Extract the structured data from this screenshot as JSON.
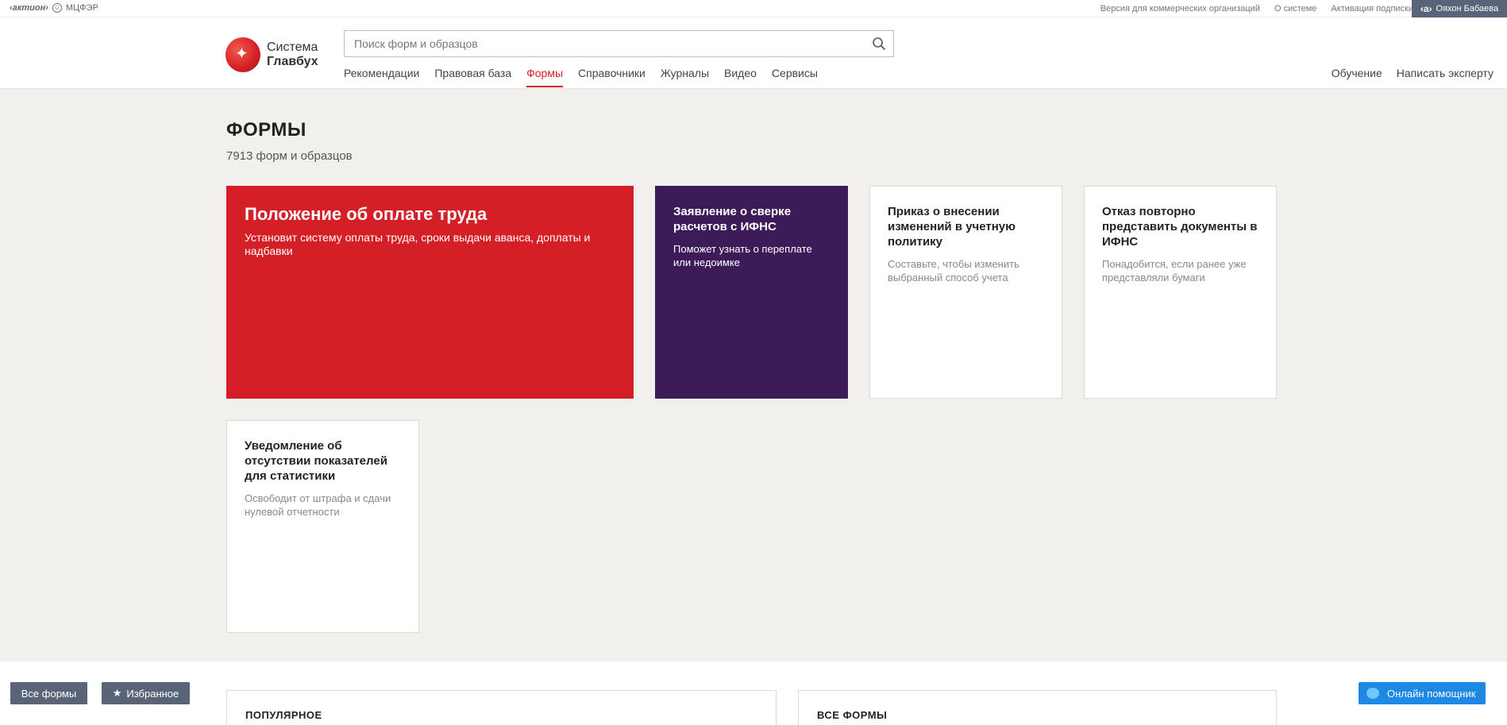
{
  "topbar": {
    "brand_main": "‹актион›",
    "brand_sub": "МЦФЭР",
    "links": [
      "Версия для коммерческих организаций",
      "О системе",
      "Активация подписки"
    ],
    "user_name": "Ояхон Бабаева"
  },
  "header": {
    "logo_line1": "Система",
    "logo_line2": "Главбух",
    "search_placeholder": "Поиск форм и образцов",
    "nav": [
      "Рекомендации",
      "Правовая база",
      "Формы",
      "Справочники",
      "Журналы",
      "Видео",
      "Сервисы"
    ],
    "nav_active": "Формы",
    "nav_right": [
      "Обучение",
      "Написать эксперту"
    ]
  },
  "main": {
    "title": "ФОРМЫ",
    "subtitle": "7913 форм и образцов",
    "cards": [
      {
        "title": "Положение об оплате труда",
        "desc": "Установит систему оплаты труда, сроки выдачи аванса, доплаты и надбавки"
      },
      {
        "title": "Заявление о сверке расчетов с ИФНС",
        "desc": "Поможет узнать о переплате или недоимке"
      },
      {
        "title": "Приказ о внесении изменений в учетную политику",
        "desc": "Составьте, чтобы изменить выбранный способ учета"
      },
      {
        "title": "Отказ повторно представить документы в ИФНС",
        "desc": "Понадобится, если ранее уже представляли бумаги"
      },
      {
        "title": "Уведомление об отсутствии показателей для статистики",
        "desc": "Освободит от штрафа и сдачи нулевой отчетности"
      }
    ]
  },
  "bottom": {
    "all_forms_btn": "Все формы",
    "favorites_btn": "Избранное",
    "popular_title": "ПОПУЛЯРНОЕ",
    "all_forms_title": "ВСЕ ФОРМЫ",
    "help_btn": "Онлайн помощник"
  },
  "colors": {
    "accent_red": "#d41f26",
    "accent_purple": "#3d1b59",
    "help_blue": "#1e88e5"
  }
}
